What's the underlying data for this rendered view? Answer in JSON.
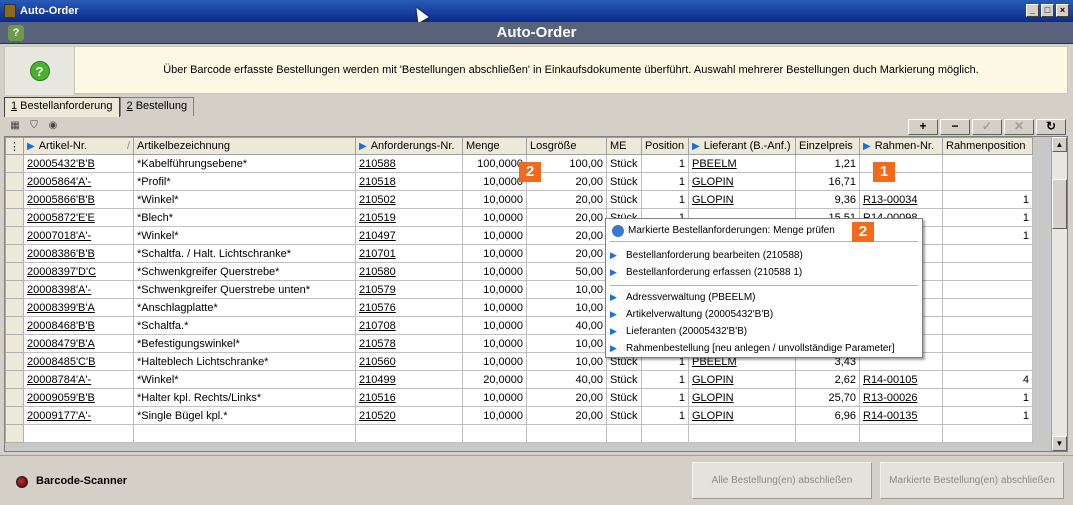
{
  "window": {
    "title": "Auto-Order",
    "controls": [
      "_",
      "□",
      "×"
    ]
  },
  "header": {
    "title": "Auto-Order"
  },
  "info": {
    "text": "Über Barcode erfasste Bestellungen werden mit 'Bestellungen abschließen' in Einkaufsdokumente überführt. Auswahl mehrerer Bestellungen duch Markierung möglich."
  },
  "tabs": [
    {
      "key": "1",
      "label": " Bestellanforderung"
    },
    {
      "key": "2",
      "label": " Bestellung"
    }
  ],
  "toolbar": {
    "add": "+",
    "remove": "−",
    "check": "✓",
    "cancel": "✕",
    "refresh": "↻"
  },
  "columns": [
    "Artikel-Nr.",
    "Artikelbezeichnung",
    "Anforderungs-Nr.",
    "Menge",
    "Losgröße",
    "ME",
    "Position",
    "Lieferant (B.-Anf.)",
    "Einzelpreis",
    "Rahmen-Nr.",
    "Rahmenposition"
  ],
  "rows": [
    [
      "20005432'B'B",
      "*Kabelführungsebene*",
      "210588",
      "100,0000",
      "100,00",
      "Stück",
      "1",
      "PBEELM",
      "1,21",
      "",
      ""
    ],
    [
      "20005864'A'-",
      "*Profil*",
      "210518",
      "10,0000",
      "20,00",
      "Stück",
      "1",
      "GLOPIN",
      "16,71",
      "",
      ""
    ],
    [
      "20005866'B'B",
      "*Winkel*",
      "210502",
      "10,0000",
      "20,00",
      "Stück",
      "1",
      "GLOPIN",
      "9,36",
      "R13-00034",
      "1"
    ],
    [
      "20005872'E'E",
      "*Blech*",
      "210519",
      "10,0000",
      "20,00",
      "Stück",
      "1",
      "",
      "15,51",
      "R14-00098",
      "1"
    ],
    [
      "20007018'A'-",
      "*Winkel*",
      "210497",
      "10,0000",
      "20,00",
      "Stück",
      "",
      "",
      "",
      "",
      "1"
    ],
    [
      "20008386'B'B",
      "*Schaltfa. / Halt. Lichtschranke*",
      "210701",
      "10,0000",
      "20,00",
      "Stück",
      "",
      "",
      "",
      "",
      ""
    ],
    [
      "20008397'D'C",
      "*Schwenkgreifer Querstrebe*",
      "210580",
      "10,0000",
      "50,00",
      "Stück",
      "",
      "",
      "",
      "",
      ""
    ],
    [
      "20008398'A'-",
      "*Schwenkgreifer Querstrebe unten*",
      "210579",
      "10,0000",
      "10,00",
      "Stück",
      "",
      "",
      "",
      "",
      ""
    ],
    [
      "20008399'B'A",
      "*Anschlagplatte*",
      "210576",
      "10,0000",
      "10,00",
      "Stück",
      "",
      "",
      "",
      "",
      ""
    ],
    [
      "20008468'B'B",
      "*Schaltfa.*",
      "210708",
      "10,0000",
      "40,00",
      "Stück",
      "",
      "",
      "",
      "",
      ""
    ],
    [
      "20008479'B'A",
      "*Befestigungswinkel*",
      "210578",
      "10,0000",
      "10,00",
      "Stück",
      "",
      "",
      "",
      "",
      ""
    ],
    [
      "20008485'C'B",
      "*Halteblech Lichtschranke*",
      "210560",
      "10,0000",
      "10,00",
      "Stück",
      "1",
      "PBEELM",
      "3,43",
      "",
      ""
    ],
    [
      "20008784'A'-",
      "*Winkel*",
      "210499",
      "20,0000",
      "40,00",
      "Stück",
      "1",
      "GLOPIN",
      "2,62",
      "R14-00105",
      "4"
    ],
    [
      "20009059'B'B",
      "*Halter kpl. Rechts/Links*",
      "210516",
      "10,0000",
      "20,00",
      "Stück",
      "1",
      "GLOPIN",
      "25,70",
      "R13-00026",
      "1"
    ],
    [
      "20009177'A'-",
      "*Single Bügel kpl.*",
      "210520",
      "10,0000",
      "20,00",
      "Stück",
      "1",
      "GLOPIN",
      "6,96",
      "R14-00135",
      "1"
    ]
  ],
  "badges": [
    "2",
    "1",
    "2"
  ],
  "context_menu": {
    "first": "Markierte Bestellanforderungen: Menge prüfen",
    "items": [
      "Bestellanforderung bearbeiten  (210588)",
      "Bestellanforderung erfassen  (210588 1)",
      "Adressverwaltung  (PBEELM)",
      "Artikelverwaltung  (20005432'B'B)",
      "Lieferanten  (20005432'B'B)",
      "Rahmenbestellung [neu anlegen / unvollständige Parameter]"
    ]
  },
  "status": {
    "scanner_label": "Barcode-Scanner",
    "btn_all": "Alle Bestellung(en) abschließen",
    "btn_marked": "Markierte Bestellung(en) abschließen"
  }
}
